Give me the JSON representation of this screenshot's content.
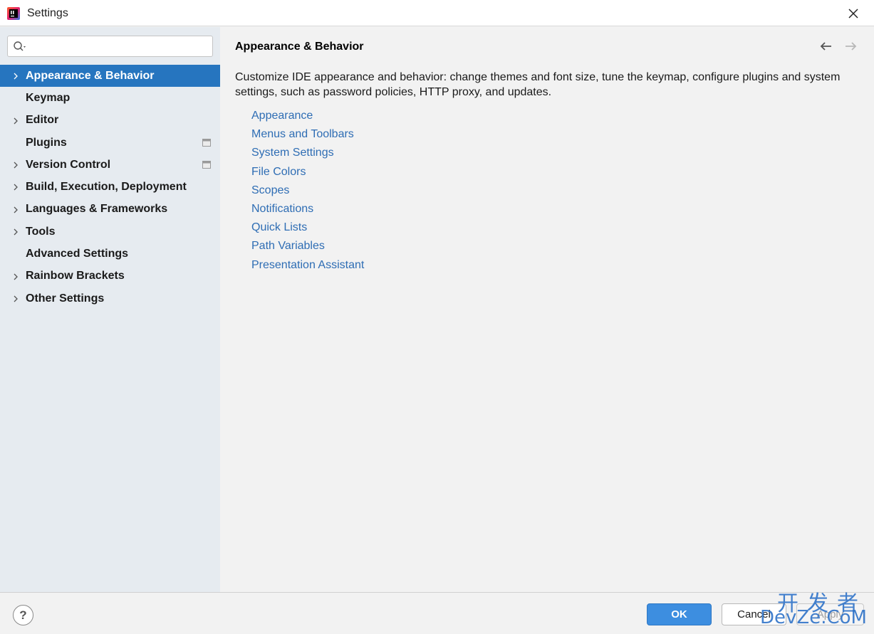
{
  "window": {
    "title": "Settings",
    "app_icon": "intellij-idea-icon",
    "close_icon": "close-icon"
  },
  "search": {
    "placeholder": "",
    "value": "",
    "icon": "search-icon"
  },
  "sidebar": {
    "selected_color": "#2675bf",
    "items": [
      {
        "label": "Appearance & Behavior",
        "expandable": true,
        "selected": true,
        "project_icon": false
      },
      {
        "label": "Keymap",
        "expandable": false,
        "selected": false,
        "project_icon": false
      },
      {
        "label": "Editor",
        "expandable": true,
        "selected": false,
        "project_icon": false
      },
      {
        "label": "Plugins",
        "expandable": false,
        "selected": false,
        "project_icon": true
      },
      {
        "label": "Version Control",
        "expandable": true,
        "selected": false,
        "project_icon": true
      },
      {
        "label": "Build, Execution, Deployment",
        "expandable": true,
        "selected": false,
        "project_icon": false
      },
      {
        "label": "Languages & Frameworks",
        "expandable": true,
        "selected": false,
        "project_icon": false
      },
      {
        "label": "Tools",
        "expandable": true,
        "selected": false,
        "project_icon": false
      },
      {
        "label": "Advanced Settings",
        "expandable": false,
        "selected": false,
        "project_icon": false
      },
      {
        "label": "Rainbow Brackets",
        "expandable": true,
        "selected": false,
        "project_icon": false
      },
      {
        "label": "Other Settings",
        "expandable": true,
        "selected": false,
        "project_icon": false
      }
    ]
  },
  "main": {
    "title": "Appearance & Behavior",
    "back_icon": "arrow-left-icon",
    "forward_icon": "arrow-right-icon",
    "description": "Customize IDE appearance and behavior: change themes and font size, tune the keymap, configure plugins and system settings, such as password policies, HTTP proxy, and updates.",
    "link_color": "#2e6db4",
    "links": [
      "Appearance",
      "Menus and Toolbars",
      "System Settings",
      "File Colors",
      "Scopes",
      "Notifications",
      "Quick Lists",
      "Path Variables",
      "Presentation Assistant"
    ]
  },
  "footer": {
    "help_label": "?",
    "ok_label": "OK",
    "cancel_label": "Cancel",
    "apply_label": "Apply",
    "ok_color": "#3d8ee0"
  },
  "watermark": {
    "line1": "开发者",
    "line2": "DevZe.CoM"
  }
}
